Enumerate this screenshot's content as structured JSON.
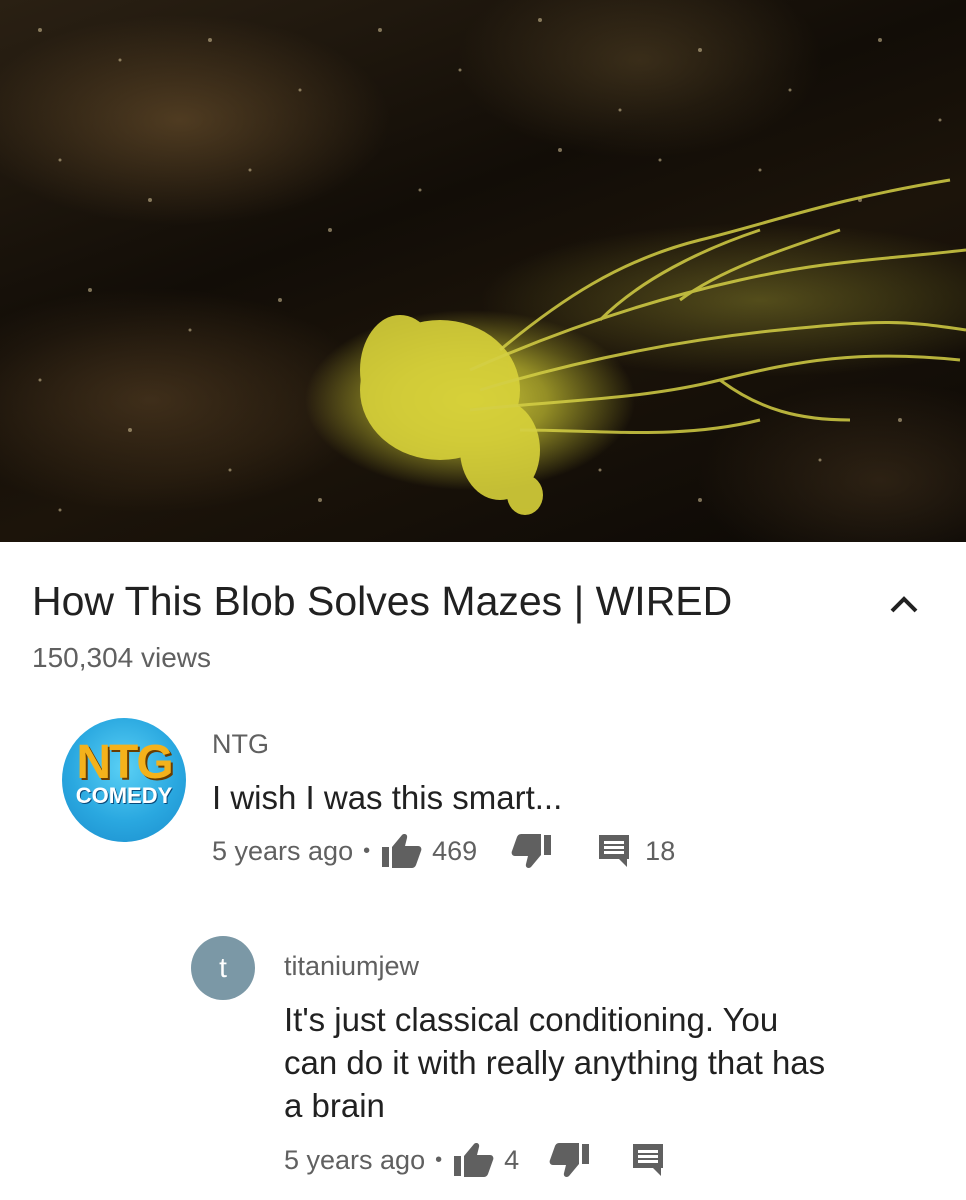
{
  "video": {
    "title": "How This Blob Solves Mazes | WIRED",
    "views": "150,304 views"
  },
  "comments": [
    {
      "author": "NTG",
      "avatar_text_top": "NTG",
      "avatar_text_bottom": "COMEDY",
      "text": "I wish I was this smart...",
      "time": "5 years ago",
      "likes": "469",
      "replies": "18"
    },
    {
      "author": "titaniumjew",
      "avatar_letter": "t",
      "avatar_color": "#7b98a6",
      "text_lines": [
        "It's just classical conditioning. You",
        "can do it with really anything that has",
        "a brain"
      ],
      "time": "5 years ago",
      "likes": "4"
    }
  ],
  "icons": {
    "collapse": "chevron-up-icon",
    "like": "thumbs-up-icon",
    "dislike": "thumbs-down-icon",
    "reply": "comment-icon"
  }
}
